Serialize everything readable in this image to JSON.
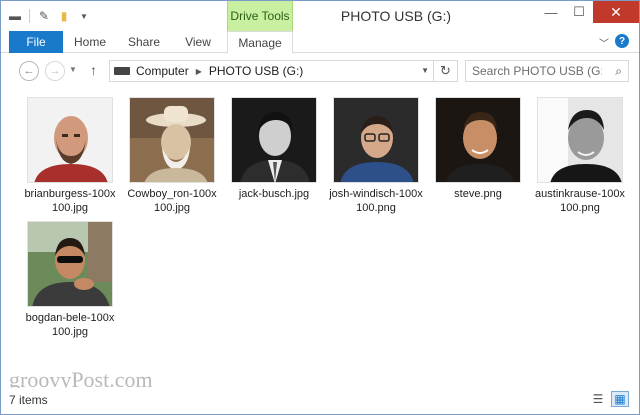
{
  "window": {
    "title": "PHOTO USB (G:)"
  },
  "title_bar": {
    "context_tab_group": "Drive Tools",
    "minimize": "—",
    "maximize": "☐",
    "close": "✕"
  },
  "ribbon": {
    "tabs": [
      {
        "label": "File",
        "active": false
      },
      {
        "label": "Home",
        "active": false
      },
      {
        "label": "Share",
        "active": false
      },
      {
        "label": "View",
        "active": false
      },
      {
        "label": "Manage",
        "active": true
      }
    ],
    "help_label": "?"
  },
  "navigation": {
    "breadcrumbs": [
      "Computer",
      "PHOTO USB (G:)"
    ],
    "search_placeholder": "Search PHOTO USB (G:)"
  },
  "files": [
    {
      "name": "brianburgess-100x100.jpg",
      "thumb_style": "bald-redshirt"
    },
    {
      "name": "Cowboy_ron-100x100.jpg",
      "thumb_style": "cowboy-sepia"
    },
    {
      "name": "jack-busch.jpg",
      "thumb_style": "bw-suit"
    },
    {
      "name": "josh-windisch-100x100.png",
      "thumb_style": "glasses-blue"
    },
    {
      "name": "steve.png",
      "thumb_style": "dark-smile"
    },
    {
      "name": "austinkrause-100x100.png",
      "thumb_style": "bw-shadow"
    },
    {
      "name": "bogdan-bele-100x100.jpg",
      "thumb_style": "sunglasses-outdoor"
    }
  ],
  "status": {
    "item_count": "7 items"
  },
  "watermark": "groovyPost.com",
  "colors": {
    "accent": "#1979ca",
    "context_tab": "#c8f0a0",
    "close_button": "#c0392b"
  }
}
